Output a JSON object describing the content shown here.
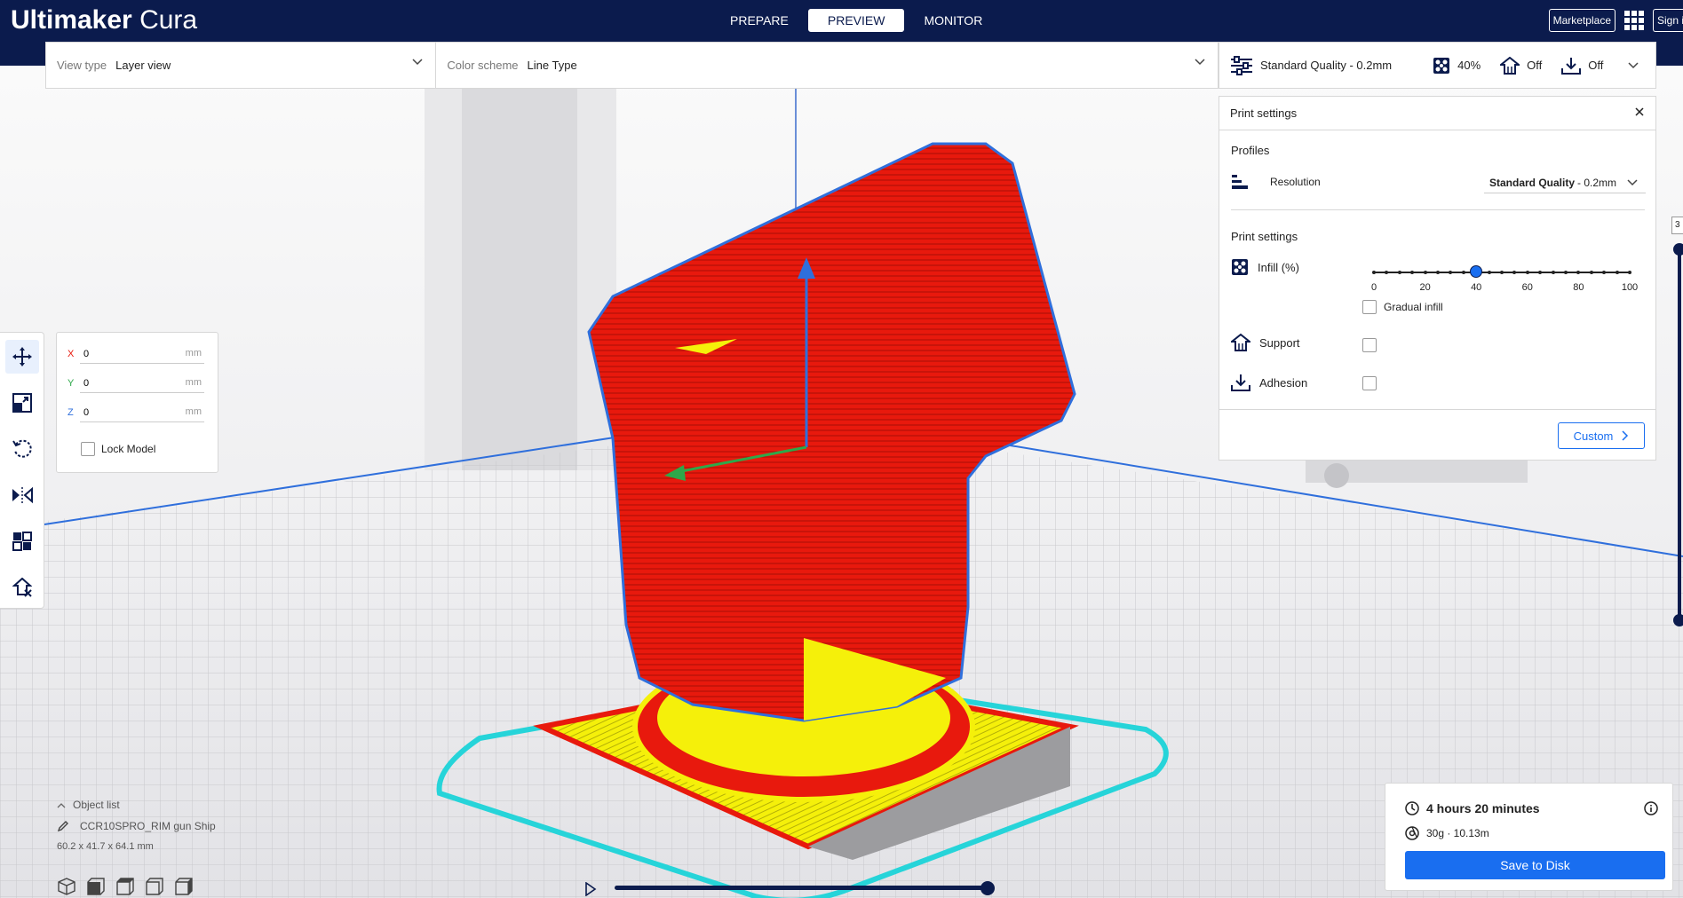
{
  "app": {
    "brand_bold": "Ultimaker",
    "brand_light": "Cura"
  },
  "stages": [
    {
      "label": "PREPARE",
      "active": false
    },
    {
      "label": "PREVIEW",
      "active": true
    },
    {
      "label": "MONITOR",
      "active": false
    }
  ],
  "header": {
    "marketplace": "Marketplace",
    "signin": "Sign in"
  },
  "viewbar": {
    "view_type_label": "View type",
    "view_type_value": "Layer view",
    "color_scheme_label": "Color scheme",
    "color_scheme_value": "Line Type"
  },
  "print_summary": {
    "profile": "Standard Quality - 0.2mm",
    "infill": "40%",
    "support": "Off",
    "adhesion": "Off"
  },
  "print_panel": {
    "title": "Print settings",
    "profiles_title": "Profiles",
    "resolution_label": "Resolution",
    "resolution_bold": "Standard Quality",
    "resolution_rest": "- 0.2mm",
    "settings_title": "Print settings",
    "infill_label": "Infill (%)",
    "infill_value": 40,
    "infill_ticks": [
      "0",
      "20",
      "40",
      "60",
      "80",
      "100"
    ],
    "gradual_infill_label": "Gradual infill",
    "support_label": "Support",
    "adhesion_label": "Adhesion",
    "custom_button": "Custom"
  },
  "translate": {
    "x_label": "X",
    "x_value": "0",
    "y_label": "Y",
    "y_value": "0",
    "z_label": "Z",
    "z_value": "0",
    "unit": "mm",
    "lock_label": "Lock Model"
  },
  "object_list": {
    "toggle_label": "Object list",
    "object_name": "CCR10SPRO_RIM gun Ship",
    "dimensions": "60.2 x 41.7 x 64.1 mm"
  },
  "layer": {
    "current_prefix": "3"
  },
  "output": {
    "print_time": "4 hours 20 minutes",
    "material": "30g · 10.13m",
    "save_button": "Save to Disk"
  },
  "icons": {
    "move": "move-icon",
    "scale": "scale-icon",
    "rotate": "rotate-icon",
    "mirror": "mirror-icon",
    "per_model": "per-model-settings-icon",
    "support_blocker": "support-blocker-icon"
  },
  "colors": {
    "header": "#0b1b4d",
    "accent": "#196ef0",
    "wall": "#e8190d",
    "skin": "#f5f00a",
    "skirt": "#26d4d9"
  }
}
